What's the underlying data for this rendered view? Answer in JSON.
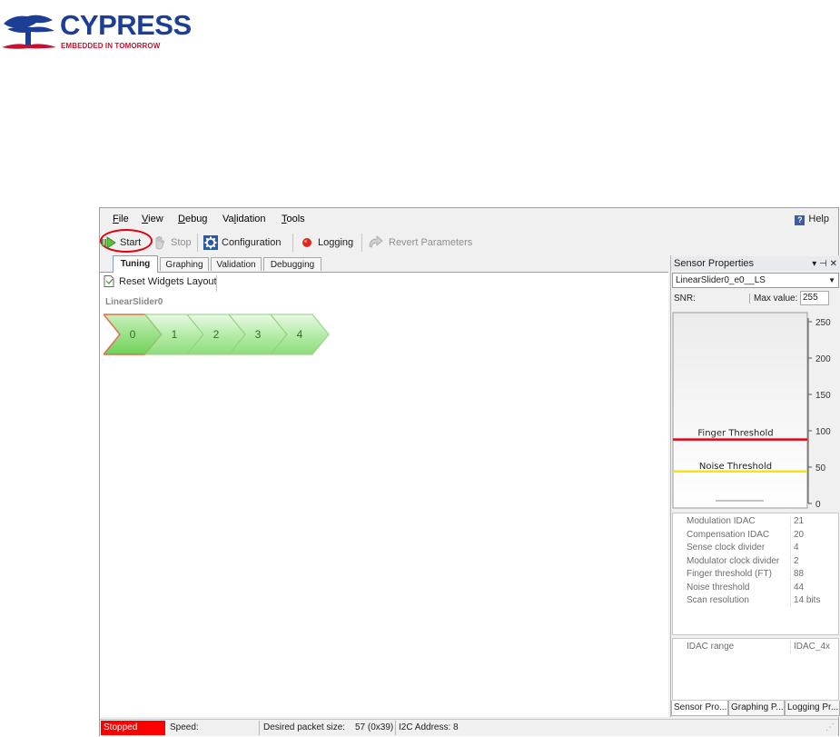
{
  "logo": {
    "brand": "CYPRESS",
    "tagline": "EMBEDDED IN TOMORROW"
  },
  "menu": {
    "items": [
      {
        "key": "F",
        "rest": "ile"
      },
      {
        "key": "V",
        "rest": "iew"
      },
      {
        "key": "D",
        "rest": "ebug"
      },
      {
        "pre": "Va",
        "key": "l",
        "rest": "idation"
      },
      {
        "key": "T",
        "rest": "ools"
      }
    ],
    "help": "Help"
  },
  "toolbar": {
    "start": "Start",
    "stop": "Stop",
    "configuration": "Configuration",
    "logging": "Logging",
    "revert": "Revert Parameters"
  },
  "tabs": [
    "Tuning",
    "Graphing",
    "Validation",
    "Debugging"
  ],
  "tuning": {
    "reset_layout": "Reset Widgets Layout",
    "widget_name": "LinearSlider0",
    "segments": [
      "0",
      "1",
      "2",
      "3",
      "4"
    ],
    "active_segment": 0
  },
  "sensor_panel": {
    "title": "Sensor Properties",
    "selected_sensor": "LinearSlider0_e0__LS",
    "snr_label": "SNR:",
    "max_value_label": "Max value:",
    "max_value": "255",
    "chart": {
      "y_ticks": [
        "250",
        "200",
        "150",
        "100",
        "50",
        "0"
      ],
      "finger_threshold_label": "Finger Threshold",
      "noise_threshold_label": "Noise Threshold",
      "finger_threshold": 88,
      "noise_threshold": 44,
      "max": 255,
      "finger_color": "#e8000b",
      "noise_color": "#f5e800"
    },
    "properties": [
      {
        "name": "Modulation IDAC",
        "value": "21"
      },
      {
        "name": "Compensation IDAC",
        "value": "20"
      },
      {
        "name": "Sense clock divider",
        "value": "4"
      },
      {
        "name": "Modulator clock divider",
        "value": "2"
      },
      {
        "name": "Finger threshold (FT)",
        "value": "88"
      },
      {
        "name": "Noise threshold",
        "value": "44"
      },
      {
        "name": "Scan resolution",
        "value": "14 bits"
      }
    ],
    "extra_properties": [
      {
        "name": "IDAC range",
        "value": "IDAC_4x"
      }
    ],
    "bottom_tabs": [
      "Sensor Pro...",
      "Graphing P...",
      "Logging Pr..."
    ]
  },
  "status": {
    "state": "Stopped",
    "speed_label": "Speed:",
    "packet_label": "Desired packet size:",
    "packet_value": "57 (0x39)",
    "i2c": "I2C Address: 8"
  }
}
